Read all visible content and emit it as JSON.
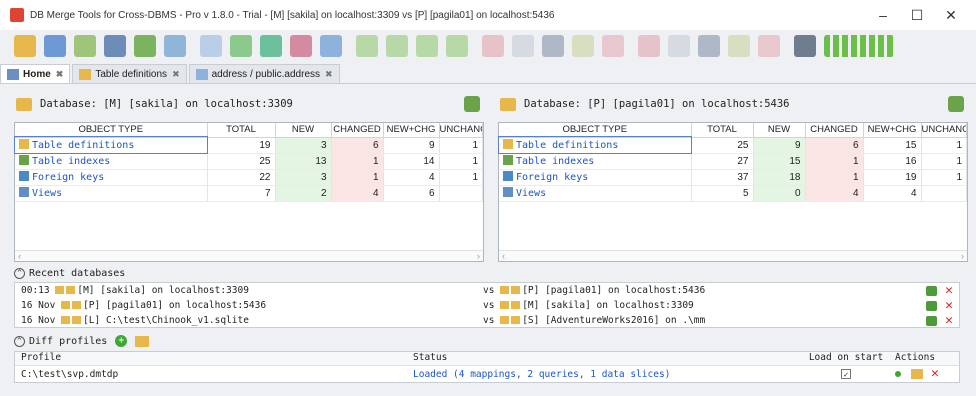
{
  "window": {
    "title": "DB Merge Tools for Cross-DBMS - Pro v 1.8.0 - Trial - [M] [sakila] on localhost:3309 vs [P] [pagila01] on localhost:5436"
  },
  "tabs": [
    {
      "label": "Home",
      "icon": "home-icon"
    },
    {
      "label": "Table definitions",
      "icon": "table-icon"
    },
    {
      "label": "address / public.address",
      "icon": "table-icon"
    }
  ],
  "left": {
    "title": "Database: [M] [sakila] on localhost:3309",
    "columns": [
      "OBJECT TYPE",
      "TOTAL",
      "NEW",
      "CHANGED",
      "NEW+CHG",
      "UNCHANG"
    ],
    "rows": [
      {
        "name": "Table definitions",
        "total": "19",
        "new": "3",
        "changed": "6",
        "newchg": "9",
        "unch": "1"
      },
      {
        "name": "Table indexes",
        "total": "25",
        "new": "13",
        "changed": "1",
        "newchg": "14",
        "unch": "1"
      },
      {
        "name": "Foreign keys",
        "total": "22",
        "new": "3",
        "changed": "1",
        "newchg": "4",
        "unch": "1"
      },
      {
        "name": "Views",
        "total": "7",
        "new": "2",
        "changed": "4",
        "newchg": "6",
        "unch": ""
      }
    ]
  },
  "right": {
    "title": "Database: [P] [pagila01] on localhost:5436",
    "columns": [
      "OBJECT TYPE",
      "TOTAL",
      "NEW",
      "CHANGED",
      "NEW+CHG",
      "UNCHANG"
    ],
    "rows": [
      {
        "name": "Table definitions",
        "total": "25",
        "new": "9",
        "changed": "6",
        "newchg": "15",
        "unch": "1"
      },
      {
        "name": "Table indexes",
        "total": "27",
        "new": "15",
        "changed": "1",
        "newchg": "16",
        "unch": "1"
      },
      {
        "name": "Foreign keys",
        "total": "37",
        "new": "18",
        "changed": "1",
        "newchg": "19",
        "unch": "1"
      },
      {
        "name": "Views",
        "total": "5",
        "new": "0",
        "changed": "4",
        "newchg": "4",
        "unch": ""
      }
    ]
  },
  "recent": {
    "header": "Recent databases",
    "rows": [
      {
        "when": "00:13",
        "left": "[M] [sakila] on localhost:3309",
        "vs": "vs",
        "right": "[P] [pagila01] on localhost:5436"
      },
      {
        "when": "16 Nov",
        "left": "[P] [pagila01] on localhost:5436",
        "vs": "vs",
        "right": "[M] [sakila] on localhost:3309"
      },
      {
        "when": "16 Nov",
        "left": "[L] C:\\test\\Chinook_v1.sqlite",
        "vs": "vs",
        "right": "[S] [AdventureWorks2016] on .\\mm"
      }
    ]
  },
  "profiles": {
    "header": "Diff profiles",
    "columns": {
      "profile": "Profile",
      "status": "Status",
      "load": "Load on start",
      "actions": "Actions"
    },
    "rows": [
      {
        "profile": "C:\\test\\svp.dmtdp",
        "status": "Loaded (4 mappings, 2 queries, 1 data slices)",
        "load": "✓"
      }
    ]
  },
  "colors": {
    "new_bg": "#e4f5e4",
    "changed_bg": "#fbe5e5",
    "link": "#1b55c4"
  }
}
